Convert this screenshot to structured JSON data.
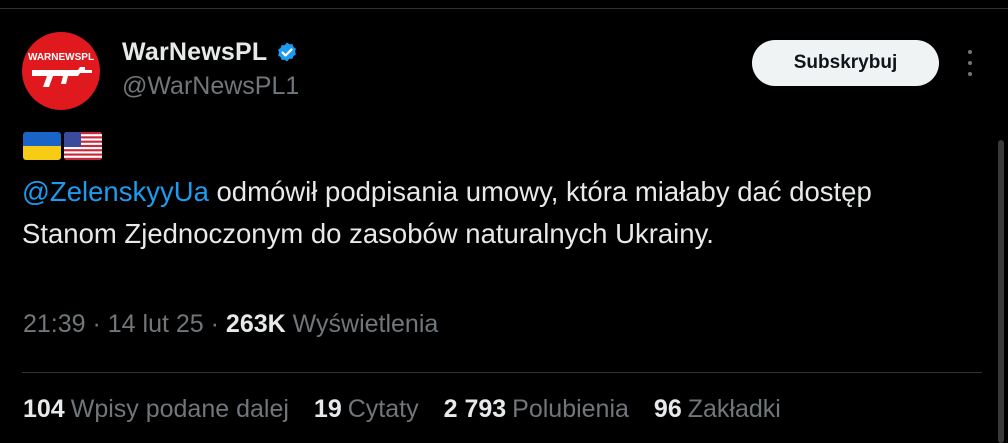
{
  "author": {
    "display_name": "WarNewsPL",
    "handle": "@WarNewsPL1",
    "avatar_text": "WARNEWSPL"
  },
  "actions": {
    "subscribe_label": "Subskrybuj"
  },
  "tweet": {
    "flags": [
      "ukraine-flag-icon",
      "usa-flag-icon"
    ],
    "mention": "@ZelenskyyUa",
    "text": " odmówił podpisania umowy, która miałaby dać dostęp Stanom Zjednoczonym do zasobów naturalnych Ukrainy."
  },
  "meta": {
    "time": "21:39",
    "sep1": " · ",
    "date": "14 lut 25",
    "sep2": " · ",
    "views_count": "263K",
    "views_label": " Wyświetlenia"
  },
  "stats": {
    "reposts_count": "104",
    "reposts_label": "Wpisy podane dalej",
    "quotes_count": "19",
    "quotes_label": "Cytaty",
    "likes_count": "2 793",
    "likes_label": "Polubienia",
    "bookmarks_count": "96",
    "bookmarks_label": "Zakładki"
  },
  "colors": {
    "background": "#000000",
    "text": "#e7e9ea",
    "muted": "#71767b",
    "accent": "#1d9bf0",
    "avatar": "#e0191f"
  }
}
